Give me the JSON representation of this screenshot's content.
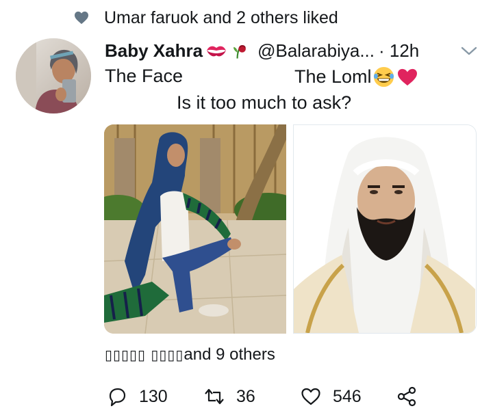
{
  "social_context": {
    "text": "Umar faruok and 2 others liked"
  },
  "tweet": {
    "display_name": "Baby Xahra",
    "handle": "@Balarabiya...",
    "time": "· 12h",
    "line1_left": "The Face",
    "line1_right": "The Loml",
    "line2": "Is it too much to ask?",
    "liked_by_name": "▯▯▯▯▯ ▯▯▯▯",
    "liked_by_suffix": " and 9 others",
    "emojis": [
      "kiss-mark-icon",
      "wilted-rose-icon",
      "grinning-squinting-face-icon",
      "pink-heart-icon"
    ]
  },
  "actions": {
    "reply_count": "130",
    "retweet_count": "36",
    "like_count": "546"
  },
  "colors": {
    "text": "#14171a",
    "icon_gray": "#657786",
    "kiss_red": "#e0245e",
    "heart_pink": "#e0245e"
  }
}
